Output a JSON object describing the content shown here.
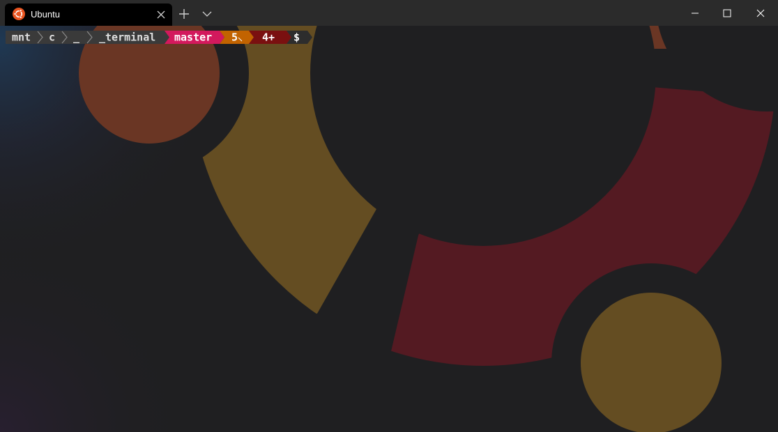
{
  "window": {
    "tab_title": "Ubuntu",
    "tab_icon": "ubuntu-logo-icon",
    "accent": "#e95420"
  },
  "controls": {
    "new_tab_icon": "plus-icon",
    "dropdown_icon": "chevron-down-icon",
    "minimize_icon": "minimize-icon",
    "maximize_icon": "maximize-icon",
    "close_icon": "close-icon"
  },
  "prompt": {
    "path_segments": [
      "mnt",
      "c",
      "_",
      "_terminal"
    ],
    "branch": "master",
    "modified_count": "5",
    "staged_count": "4+",
    "symbol": "$",
    "colors": {
      "path_bg": "#3a3a3a",
      "path_fg": "#dedede",
      "branch_bg": "#d3195d",
      "modified_bg": "#c26300",
      "staged_bg": "#7a1010",
      "prompt_bg": "#2d2d2d"
    }
  },
  "background": {
    "description_colors": [
      "#6a3624",
      "#644d22",
      "#541a22",
      "#1f1f21"
    ]
  }
}
